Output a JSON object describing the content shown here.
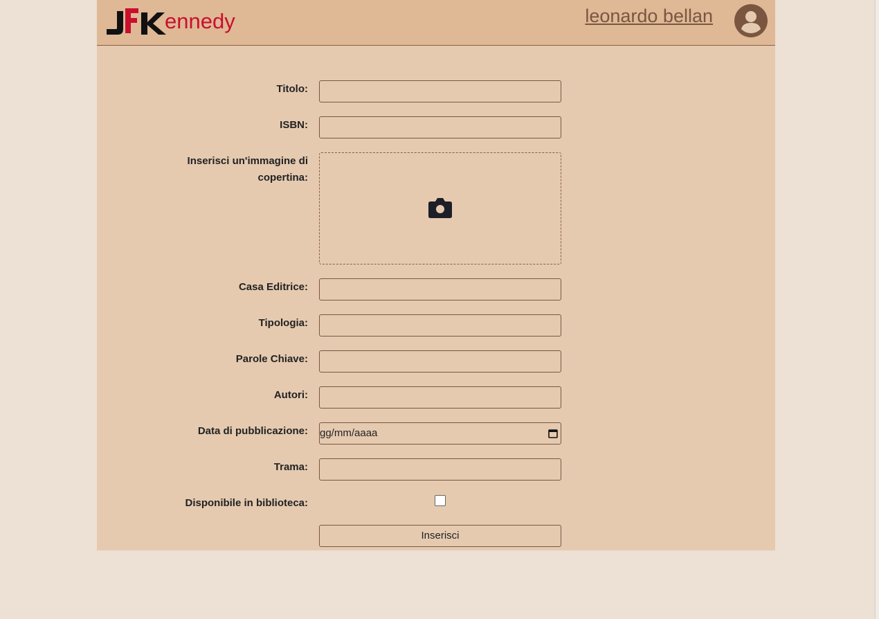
{
  "header": {
    "logo_text": "JFKennedy",
    "user_name": "leonardo bellan",
    "avatar_icon": "user-circle-icon",
    "background": "#dfb896"
  },
  "form": {
    "fields": [
      {
        "label": "Titolo:",
        "value": ""
      },
      {
        "label": "ISBN:",
        "value": ""
      },
      {
        "label": "Inserisci un'immagine di copertina:",
        "icon": "camera-icon"
      },
      {
        "label": "Casa Editrice:",
        "value": ""
      },
      {
        "label": "Tipologia:",
        "value": ""
      },
      {
        "label": "Parole Chiave:",
        "value": ""
      },
      {
        "label": "Autori:",
        "value": ""
      },
      {
        "label": "Data di pubblicazione:",
        "placeholder": "gg/mm/aaaa",
        "icon": "calendar-icon"
      },
      {
        "label": "Trama:",
        "value": ""
      },
      {
        "label": "Disponibile in biblioteca:",
        "checked": false
      }
    ],
    "submit_label": "Inserisci"
  },
  "colors": {
    "page_bg": "#ede0d4",
    "form_bg": "#e5cab0",
    "accent": "#7a5640",
    "logo_red": "#c8102e"
  }
}
